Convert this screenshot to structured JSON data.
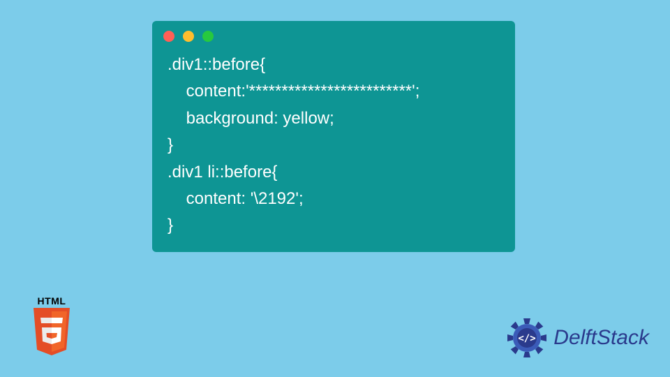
{
  "code": {
    "line1": ".div1::before{",
    "line2": "    content:'*************************';",
    "line3": "    background: yellow;",
    "line4": "}",
    "line5": ".div1 li::before{",
    "line6": "    content: '\\2192';",
    "line7": "}"
  },
  "html5_label": "HTML",
  "brand": "DelftStack",
  "colors": {
    "background": "#7cccea",
    "window": "#0e9594",
    "code_text": "#ffffff",
    "brand_text": "#2a3a8c"
  }
}
